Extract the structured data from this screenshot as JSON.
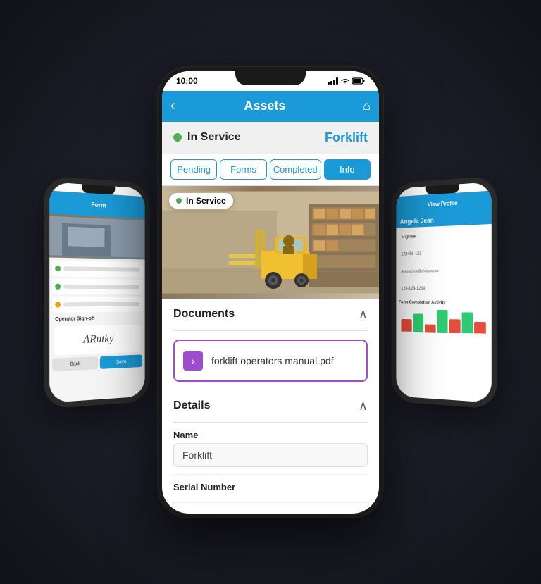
{
  "scene": {
    "background": "dark"
  },
  "status_bar": {
    "time": "10:00",
    "signal": "full",
    "wifi": true,
    "battery": "full"
  },
  "app_header": {
    "back_label": "‹",
    "title": "Assets",
    "home_icon": "🏠"
  },
  "asset": {
    "status": "In Service",
    "status_color": "#4CAF50",
    "name": "Forklift"
  },
  "tabs": [
    {
      "id": "pending",
      "label": "Pending",
      "active": false
    },
    {
      "id": "forms",
      "label": "Forms",
      "active": false
    },
    {
      "id": "completed",
      "label": "Completed",
      "active": false
    },
    {
      "id": "info",
      "label": "Info",
      "active": true
    }
  ],
  "image_overlay": {
    "status_label": "In Service"
  },
  "documents_section": {
    "title": "Documents",
    "collapsed": false,
    "items": [
      {
        "name": "forklift operators manual.pdf"
      }
    ]
  },
  "details_section": {
    "title": "Details",
    "fields": [
      {
        "label": "Name",
        "value": "Forklift"
      },
      {
        "label": "Serial Number",
        "value": ""
      }
    ]
  },
  "left_phone": {
    "header": "Form",
    "section_label": "Operator Sign-off",
    "signature_text": "ARutky"
  },
  "right_phone": {
    "header": "View Profile",
    "name": "Angela Jean",
    "fields": [
      "Engineer",
      "123456-123",
      "Angela.jean@company.ca",
      "123-123-1234"
    ],
    "chart_label": "Form Completion Activity",
    "bars": [
      {
        "color": "#e74c3c",
        "height": 30
      },
      {
        "color": "#2ecc71",
        "height": 50
      },
      {
        "color": "#e74c3c",
        "height": 20
      },
      {
        "color": "#2ecc71",
        "height": 70
      },
      {
        "color": "#e74c3c",
        "height": 40
      },
      {
        "color": "#2ecc71",
        "height": 60
      },
      {
        "color": "#e74c3c",
        "height": 35
      }
    ]
  }
}
